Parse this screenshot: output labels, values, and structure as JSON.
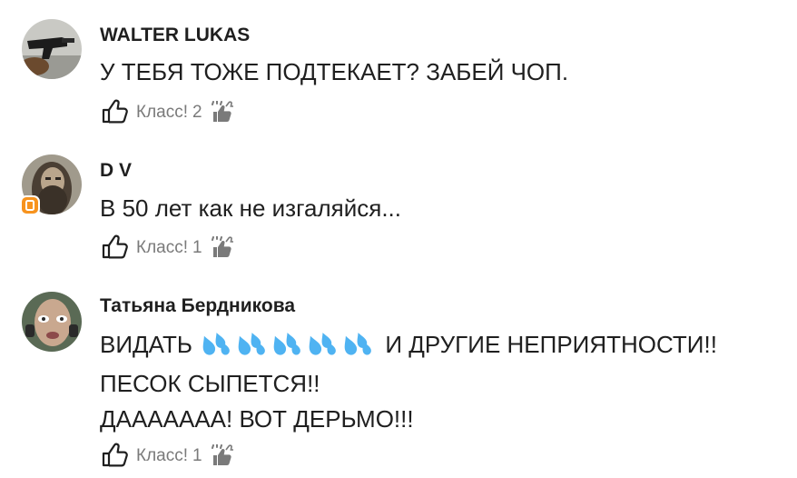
{
  "comments": [
    {
      "author": "WALTER LUKAS",
      "lines": [
        "У ТЕБЯ ТОЖЕ ПОДТЕКАЕТ? ЗАБЕЙ ЧОП."
      ],
      "like_label": "Класс!",
      "like_count": "2"
    },
    {
      "author": "D V",
      "lines": [
        "В 50 лет как не изгаляйся..."
      ],
      "like_label": "Класс!",
      "like_count": "1"
    },
    {
      "author": "Татьяна Бердникова",
      "line1_before": "ВИДАТЬ",
      "line1_after": "И ДРУГИЕ НЕПРИЯТНОСТИ!!",
      "lines": [
        "ПЕСОК СЫПЕТСЯ!!",
        "ДААААААА! ВОТ ДЕРЬМО!!!"
      ],
      "like_label": "Класс!",
      "like_count": "1"
    }
  ],
  "icons": {
    "like": "thumbs-up-icon",
    "likers": "thumbs-up-group-icon",
    "badge": "orange-badge-icon",
    "drops": "sweat-droplets-emoji"
  },
  "colors": {
    "text": "#1f1f1f",
    "muted": "#7a7a7a",
    "badge": "#f7931e",
    "drops": "#4fb3f2"
  }
}
